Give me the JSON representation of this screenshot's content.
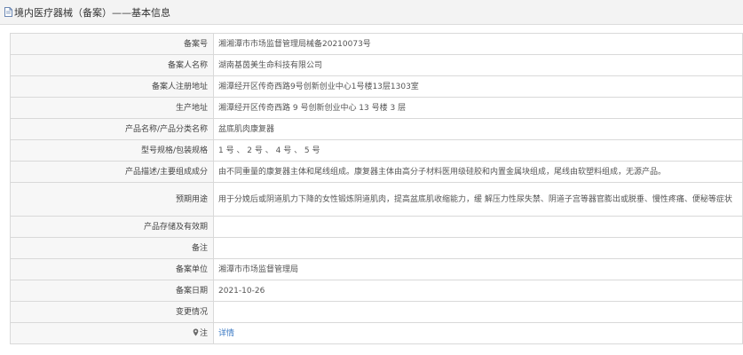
{
  "header": {
    "title": "境内医疗器械（备案）——基本信息"
  },
  "rows": [
    {
      "label": "备案号",
      "value": "湘湘潭市市场监督管理局械备20210073号"
    },
    {
      "label": "备案人名称",
      "value": "湖南基茵美生命科技有限公司"
    },
    {
      "label": "备案人注册地址",
      "value": "湘潭经开区传奇西路9号创新创业中心1号楼13层1303室"
    },
    {
      "label": "生产地址",
      "value": "湘潭经开区传奇西路 9 号创新创业中心 13 号楼 3 层"
    },
    {
      "label": "产品名称/产品分类名称",
      "value": "盆底肌肉康复器"
    },
    {
      "label": "型号规格/包装规格",
      "value": "1 号 、 2 号 、 4 号 、 5 号"
    },
    {
      "label": "产品描述/主要组成成分",
      "value": "由不同重量的康复器主体和尾线组成。康复器主体由高分子材料医用级硅胶和内置金属块组成，尾线由软塑料组成，无源产品。"
    },
    {
      "label": "预期用途",
      "value": "用于分娩后或阴道肌力下降的女性锻炼阴道肌肉，提高盆底肌收缩能力，缓 解压力性尿失禁、阴道子宫等器官膨出或脱垂、慢性疼痛、便秘等症状"
    },
    {
      "label": "产品存储及有效期",
      "value": ""
    },
    {
      "label": "备注",
      "value": ""
    },
    {
      "label": "备案单位",
      "value": "湘潭市市场监督管理局"
    },
    {
      "label": "备案日期",
      "value": "2021-10-26"
    },
    {
      "label": "变更情况",
      "value": ""
    },
    {
      "label": "注",
      "value": "详情"
    }
  ]
}
